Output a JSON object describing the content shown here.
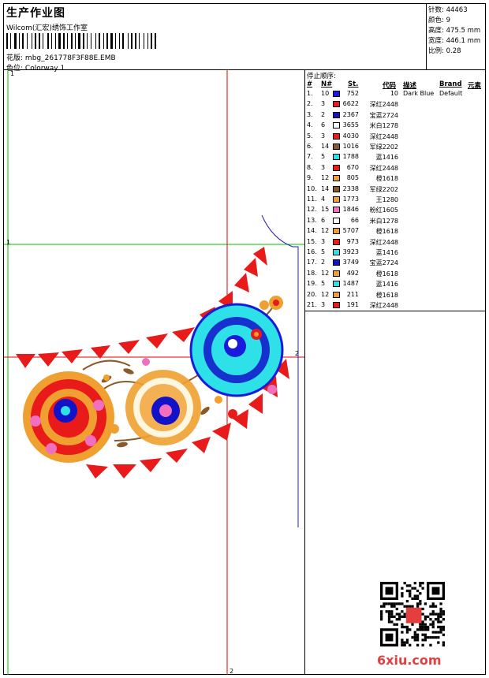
{
  "header": {
    "title": "生产作业图",
    "company": "Wilcom(汇宏)绣饰工作室",
    "design_label": "花版:",
    "design_file": "mbg_261778F3F88E.EMB",
    "color_label": "色位:",
    "colorway": "Colorway 1"
  },
  "stats": [
    {
      "label": "针数:",
      "value": "44463"
    },
    {
      "label": "颜色:",
      "value": "9"
    },
    {
      "label": "高度:",
      "value": "475.5 mm"
    },
    {
      "label": "宽度:",
      "value": "446.1 mm"
    },
    {
      "label": "比例:",
      "value": "0.28"
    }
  ],
  "canvas_markers": {
    "top_left": "1",
    "mid_left": "1",
    "mid_right": "2",
    "bottom": "2"
  },
  "stop_sequence": {
    "title": "停止顺序:",
    "headers": {
      "idx": "#",
      "needle": "N#",
      "stitches": "St.",
      "code": "代码",
      "desc": "描述",
      "brand": "Brand",
      "element": "元素"
    },
    "rows": [
      {
        "idx": "1.",
        "needle": "10",
        "stitches": "752",
        "color": "#1a1adb",
        "code": "10",
        "desc": "Dark Blue",
        "brand": "Default"
      },
      {
        "idx": "2.",
        "needle": "3",
        "stitches": "6622",
        "color": "#e81a1a",
        "code": "深红2448",
        "desc": "",
        "brand": ""
      },
      {
        "idx": "3.",
        "needle": "2",
        "stitches": "2367",
        "color": "#1212c8",
        "code": "宝蓝2724",
        "desc": "",
        "brand": ""
      },
      {
        "idx": "4.",
        "needle": "6",
        "stitches": "3655",
        "color": "#ffffff",
        "code": "米白1278",
        "desc": "",
        "brand": ""
      },
      {
        "idx": "5.",
        "needle": "3",
        "stitches": "4030",
        "color": "#e81a1a",
        "code": "深红2448",
        "desc": "",
        "brand": ""
      },
      {
        "idx": "6.",
        "needle": "14",
        "stitches": "1016",
        "color": "#8b5a2b",
        "code": "军绿2202",
        "desc": "",
        "brand": ""
      },
      {
        "idx": "7.",
        "needle": "5",
        "stitches": "1788",
        "color": "#2ee0e8",
        "code": "蓝1416",
        "desc": "",
        "brand": ""
      },
      {
        "idx": "8.",
        "needle": "3",
        "stitches": "670",
        "color": "#e81a1a",
        "code": "深红2448",
        "desc": "",
        "brand": ""
      },
      {
        "idx": "9.",
        "needle": "12",
        "stitches": "805",
        "color": "#f0a030",
        "code": "橙1618",
        "desc": "",
        "brand": ""
      },
      {
        "idx": "10.",
        "needle": "14",
        "stitches": "2338",
        "color": "#8b5a2b",
        "code": "军绿2202",
        "desc": "",
        "brand": ""
      },
      {
        "idx": "11.",
        "needle": "4",
        "stitches": "1773",
        "color": "#f0a030",
        "code": "王1280",
        "desc": "",
        "brand": ""
      },
      {
        "idx": "12.",
        "needle": "15",
        "stitches": "1846",
        "color": "#f070c0",
        "code": "粉红1605",
        "desc": "",
        "brand": ""
      },
      {
        "idx": "13.",
        "needle": "6",
        "stitches": "66",
        "color": "#ffffff",
        "code": "米白1278",
        "desc": "",
        "brand": ""
      },
      {
        "idx": "14.",
        "needle": "12",
        "stitches": "5707",
        "color": "#f0a030",
        "code": "橙1618",
        "desc": "",
        "brand": ""
      },
      {
        "idx": "15.",
        "needle": "3",
        "stitches": "973",
        "color": "#e81a1a",
        "code": "深红2448",
        "desc": "",
        "brand": ""
      },
      {
        "idx": "16.",
        "needle": "5",
        "stitches": "3923",
        "color": "#2ee0e8",
        "code": "蓝1416",
        "desc": "",
        "brand": ""
      },
      {
        "idx": "17.",
        "needle": "2",
        "stitches": "3749",
        "color": "#1212c8",
        "code": "宝蓝2724",
        "desc": "",
        "brand": ""
      },
      {
        "idx": "18.",
        "needle": "12",
        "stitches": "492",
        "color": "#f0a030",
        "code": "橙1618",
        "desc": "",
        "brand": ""
      },
      {
        "idx": "19.",
        "needle": "5",
        "stitches": "1487",
        "color": "#2ee0e8",
        "code": "蓝1416",
        "desc": "",
        "brand": ""
      },
      {
        "idx": "20.",
        "needle": "12",
        "stitches": "211",
        "color": "#f0a030",
        "code": "橙1618",
        "desc": "",
        "brand": ""
      },
      {
        "idx": "21.",
        "needle": "3",
        "stitches": "191",
        "color": "#e81a1a",
        "code": "深红2448",
        "desc": "",
        "brand": ""
      }
    ]
  },
  "watermark": "6xiu.com",
  "colors": {
    "guide_green": "#00c000",
    "guide_red": "#e00000",
    "guide_blue": "#2020c0",
    "accent_red": "#e81a1a"
  }
}
